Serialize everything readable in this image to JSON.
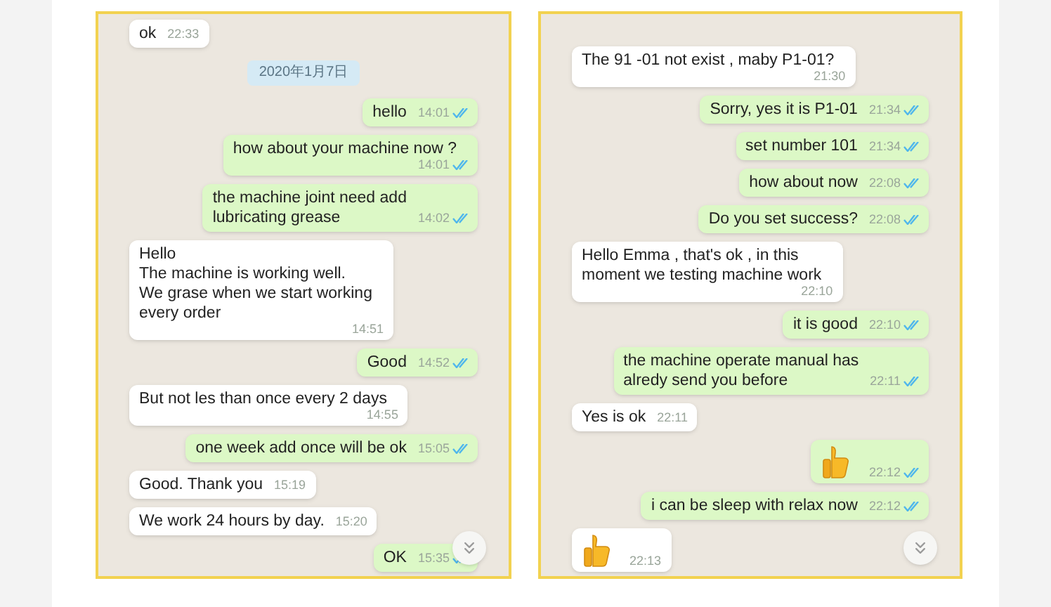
{
  "panels": [
    {
      "messages": [
        {
          "kind": "short",
          "outgoing": false,
          "text": "ok",
          "time": "22:33"
        },
        {
          "kind": "date",
          "text": "2020年1月7日"
        },
        {
          "kind": "short",
          "outgoing": true,
          "text": "hello",
          "time": "14:01",
          "read": true
        },
        {
          "kind": "long",
          "outgoing": true,
          "text": "how about your machine now ?",
          "time": "14:01",
          "read": true
        },
        {
          "kind": "short",
          "outgoing": true,
          "text": "the machine joint need add\nlubricating grease",
          "time": "14:02",
          "read": true
        },
        {
          "kind": "long",
          "outgoing": false,
          "text": "Hello\nThe machine is working well.\nWe grase when we start working\nevery order",
          "time": "14:51"
        },
        {
          "kind": "short",
          "outgoing": true,
          "text": "Good",
          "time": "14:52",
          "read": true
        },
        {
          "kind": "long",
          "outgoing": false,
          "text": "But not les than once every 2 days",
          "time": "14:55"
        },
        {
          "kind": "short",
          "outgoing": true,
          "text": "one week add once will be ok",
          "time": "15:05",
          "read": true
        },
        {
          "kind": "short",
          "outgoing": false,
          "text": "Good. Thank you",
          "time": "15:19"
        },
        {
          "kind": "short",
          "outgoing": false,
          "text": "We work 24 hours by day.",
          "time": "15:20"
        },
        {
          "kind": "short",
          "outgoing": true,
          "text": "OK",
          "time": "15:35",
          "read": true
        }
      ]
    },
    {
      "messages": [
        {
          "kind": "long",
          "outgoing": false,
          "text": "The 91 -01 not exist , maby P1-01?",
          "time": "21:30"
        },
        {
          "kind": "short",
          "outgoing": true,
          "text": "Sorry, yes it is P1-01",
          "time": "21:34",
          "read": true
        },
        {
          "kind": "short",
          "outgoing": true,
          "text": "set number 101",
          "time": "21:34",
          "read": true
        },
        {
          "kind": "short",
          "outgoing": true,
          "text": "how about now",
          "time": "22:08",
          "read": true
        },
        {
          "kind": "short",
          "outgoing": true,
          "text": "Do you set success?",
          "time": "22:08",
          "read": true
        },
        {
          "kind": "long",
          "outgoing": false,
          "text": "Hello Emma , that's ok , in this\nmoment we testing machine work",
          "time": "22:10"
        },
        {
          "kind": "short",
          "outgoing": true,
          "text": "it is good",
          "time": "22:10",
          "read": true
        },
        {
          "kind": "short",
          "outgoing": true,
          "text": "the machine operate manual has\nalredy send you before",
          "time": "22:11",
          "read": true
        },
        {
          "kind": "short",
          "outgoing": false,
          "text": "Yes is ok",
          "time": "22:11"
        },
        {
          "kind": "thumb",
          "outgoing": true,
          "time": "22:12",
          "read": true
        },
        {
          "kind": "short",
          "outgoing": true,
          "text": "i can be sleep with relax now",
          "time": "22:12",
          "read": true
        },
        {
          "kind": "thumb",
          "outgoing": false,
          "time": "22:13"
        }
      ]
    }
  ]
}
